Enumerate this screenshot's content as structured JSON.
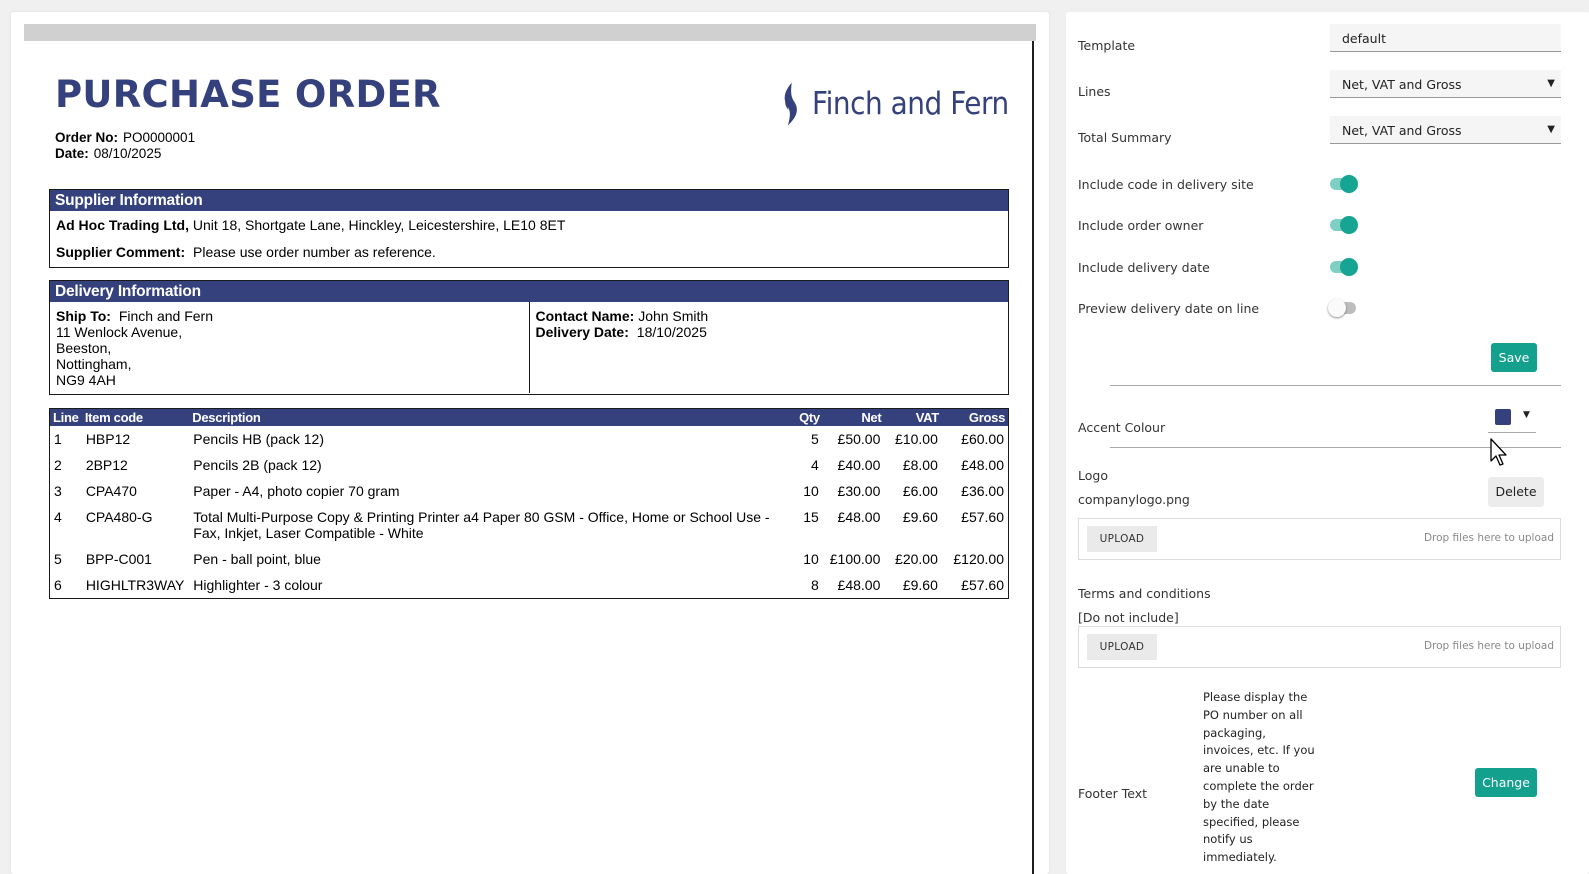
{
  "document": {
    "title": "PURCHASE ORDER",
    "order_no_label": "Order No:",
    "order_no": "PO0000001",
    "date_label": "Date:",
    "date": "08/10/2025",
    "logo_text": "Finch and Fern",
    "supplier": {
      "heading": "Supplier Information",
      "name": "Ad Hoc Trading Ltd,",
      "address": "Unit 18, Shortgate Lane, Hinckley, Leicestershire, LE10 8ET",
      "comment_label": "Supplier Comment:",
      "comment": "Please use order number as reference."
    },
    "delivery": {
      "heading": "Delivery Information",
      "ship_to_label": "Ship To:",
      "ship_to_name": "Finch and Fern",
      "address_lines": [
        "11 Wenlock Avenue,",
        "Beeston,",
        "Nottingham,",
        "NG9 4AH"
      ],
      "contact_label": "Contact Name:",
      "contact_name": "John Smith",
      "delivery_date_label": "Delivery Date:",
      "delivery_date": "18/10/2025"
    },
    "lines": {
      "headers": [
        "Line",
        "Item code",
        "Description",
        "Qty",
        "Net",
        "VAT",
        "Gross"
      ],
      "rows": [
        [
          "1",
          "HBP12",
          "Pencils HB (pack 12)",
          "5",
          "£50.00",
          "£10.00",
          "£60.00"
        ],
        [
          "2",
          "2BP12",
          "Pencils 2B (pack 12)",
          "4",
          "£40.00",
          "£8.00",
          "£48.00"
        ],
        [
          "3",
          "CPA470",
          "Paper - A4, photo copier 70 gram",
          "10",
          "£30.00",
          "£6.00",
          "£36.00"
        ],
        [
          "4",
          "CPA480-G",
          "Total Multi-Purpose Copy & Printing Printer a4 Paper 80 GSM - Office, Home or School Use - Fax, Inkjet, Laser Compatible - White",
          "15",
          "£48.00",
          "£9.60",
          "£57.60"
        ],
        [
          "5",
          "BPP-C001",
          "Pen - ball point, blue",
          "10",
          "£100.00",
          "£20.00",
          "£120.00"
        ],
        [
          "6",
          "HIGHLTR3WAY",
          "Highlighter - 3 colour",
          "8",
          "£48.00",
          "£9.60",
          "£57.60"
        ]
      ]
    }
  },
  "settings": {
    "template_label": "Template",
    "template_value": "default",
    "lines_label": "Lines",
    "lines_value": "Net, VAT and Gross",
    "total_summary_label": "Total Summary",
    "total_summary_value": "Net, VAT and Gross",
    "toggles": [
      {
        "label": "Include code in delivery site",
        "on": true
      },
      {
        "label": "Include order owner",
        "on": true
      },
      {
        "label": "Include delivery date",
        "on": true
      },
      {
        "label": "Preview delivery date on line",
        "on": false
      }
    ],
    "save_label": "Save",
    "accent_label": "Accent Colour",
    "accent_color": "#34417c",
    "logo_label": "Logo",
    "logo_file": "companylogo.png",
    "delete_label": "Delete",
    "upload_label": "UPLOAD",
    "drop_hint": "Drop files here to upload",
    "terms_label": "Terms and conditions",
    "terms_value": "[Do not include]",
    "footer_label": "Footer Text",
    "footer_value": "Please display the PO number on all packaging, invoices, etc. If you are unable to complete the order by the date specified, please notify us immediately.",
    "change_label": "Change"
  },
  "colors": {
    "brand_navy": "#34417c",
    "action_teal": "#13a08d"
  }
}
